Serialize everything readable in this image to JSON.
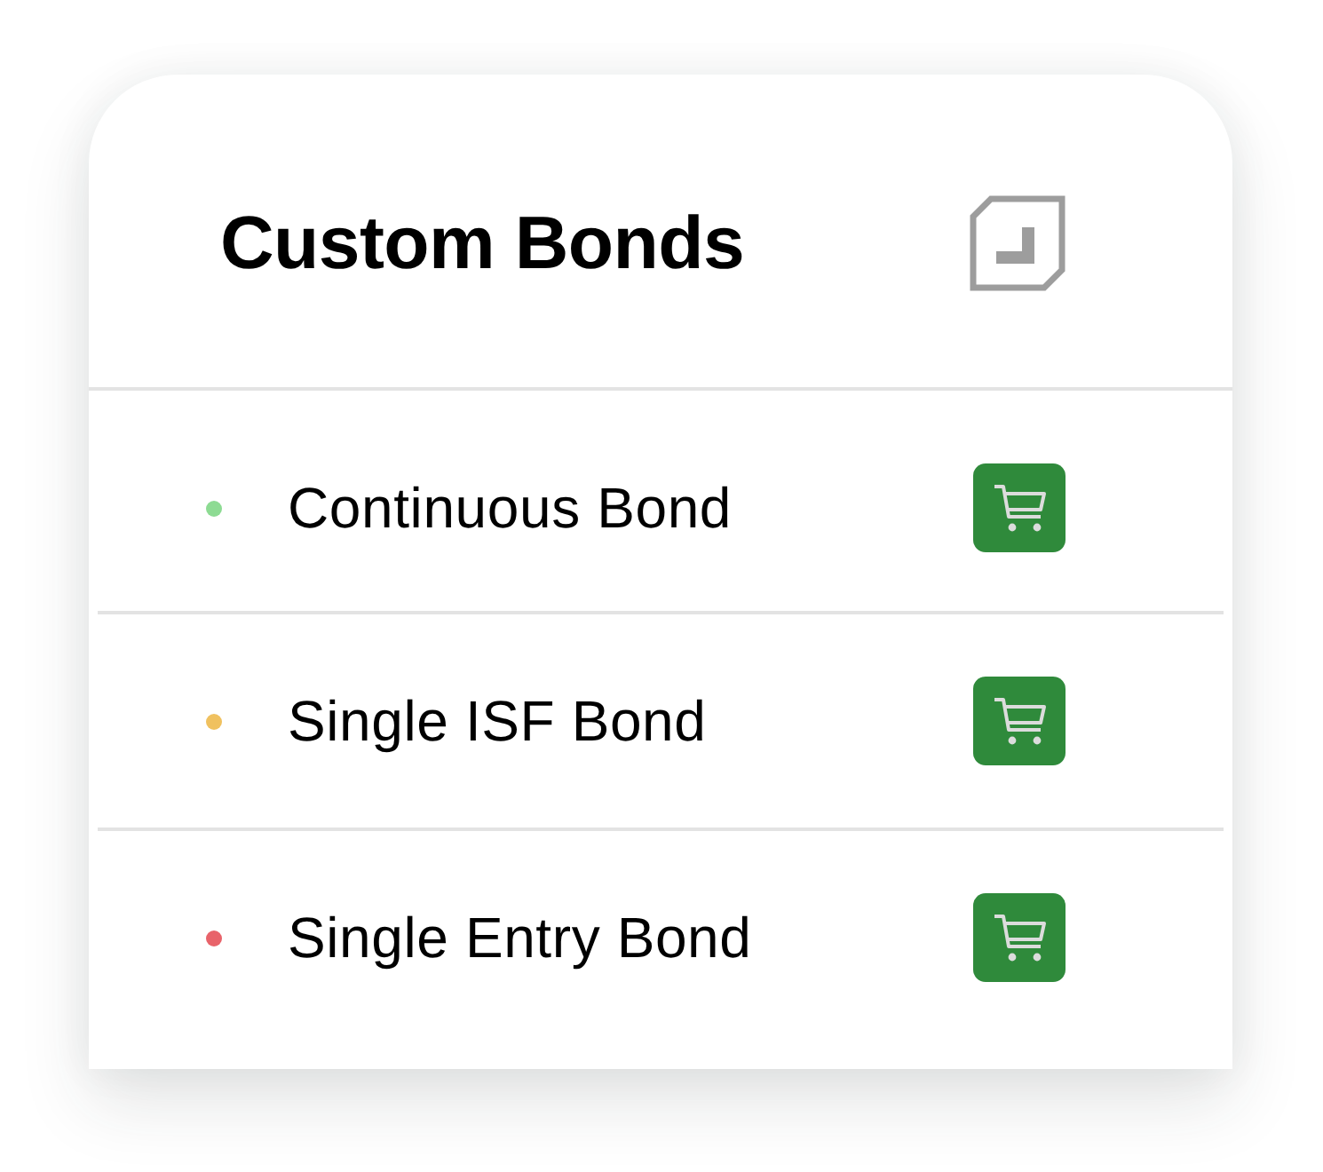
{
  "header": {
    "title": "Custom Bonds"
  },
  "bonds": [
    {
      "name": "Continuous Bond",
      "color": "#8ddb93"
    },
    {
      "name": "Single ISF Bond",
      "color": "#f0c15f"
    },
    {
      "name": "Single Entry Bond",
      "color": "#e8636a"
    }
  ]
}
